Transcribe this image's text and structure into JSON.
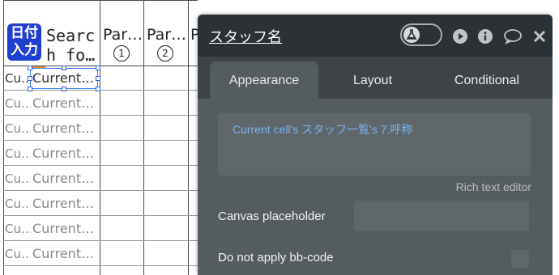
{
  "editor": {
    "header": {
      "badge_text": "日付入力",
      "col2": [
        "Searc",
        "h fo…"
      ],
      "col3": "Par…",
      "col3_num": "1",
      "col4": "Par…",
      "col4_num": "2",
      "col5": "P"
    },
    "rows": [
      {
        "c1": "Cu…",
        "c2": "Current…"
      },
      {
        "c1": "Cu…",
        "c2": "Current…"
      },
      {
        "c1": "Cu…",
        "c2": "Current…"
      },
      {
        "c1": "Cu…",
        "c2": "Current…"
      },
      {
        "c1": "Cu…",
        "c2": "Current…"
      },
      {
        "c1": "Cu…",
        "c2": "Current…"
      },
      {
        "c1": "Cu…",
        "c2": "Current…"
      },
      {
        "c1": "Cu…",
        "c2": "Current…"
      }
    ]
  },
  "panel": {
    "title": "スタッフ名",
    "tabs": [
      "Appearance",
      "Layout",
      "Conditional"
    ],
    "active_tab": "Appearance",
    "rich_text_value": "Current cell's スタッフ一覧's 7.呼称",
    "rich_text_caption": "Rich text editor",
    "canvas_placeholder_label": "Canvas placeholder",
    "bbcode_label": "Do not apply bb-code",
    "header_icons": [
      "flask-icon",
      "play-icon",
      "info-icon",
      "comment-icon",
      "close-icon"
    ]
  },
  "colors": {
    "panel_bg": "#3d4347",
    "panel_body": "#555c60",
    "link_blue": "#78b2ef",
    "badge_blue": "#1f3fd1",
    "selection_blue": "#3b82f6"
  }
}
